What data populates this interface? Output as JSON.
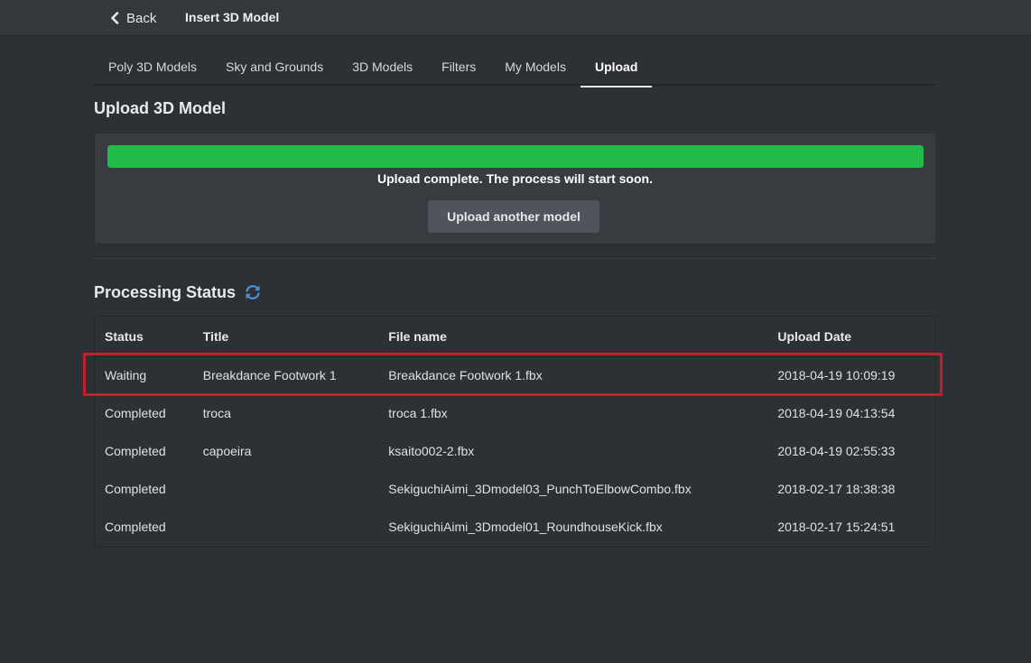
{
  "topbar": {
    "back_label": "Back",
    "title": "Insert 3D Model"
  },
  "tabs": [
    {
      "label": "Poly 3D Models",
      "active": false
    },
    {
      "label": "Sky and Grounds",
      "active": false
    },
    {
      "label": "3D Models",
      "active": false
    },
    {
      "label": "Filters",
      "active": false
    },
    {
      "label": "My Models",
      "active": false
    },
    {
      "label": "Upload",
      "active": true
    }
  ],
  "upload": {
    "heading": "Upload 3D Model",
    "progress": 1.0,
    "message": "Upload complete. The process will start soon.",
    "another_label": "Upload another model"
  },
  "processing": {
    "heading": "Processing Status",
    "columns": [
      "Status",
      "Title",
      "File name",
      "Upload Date"
    ],
    "rows": [
      {
        "status": "Waiting",
        "title": "Breakdance Footwork 1",
        "file": "Breakdance Footwork 1.fbx",
        "date": "2018-04-19 10:09:19",
        "highlighted": true
      },
      {
        "status": "Completed",
        "title": "troca",
        "file": "troca 1.fbx",
        "date": "2018-04-19 04:13:54"
      },
      {
        "status": "Completed",
        "title": "capoeira",
        "file": "ksaito002-2.fbx",
        "date": "2018-04-19 02:55:33"
      },
      {
        "status": "Completed",
        "title": "",
        "file": "SekiguchiAimi_3Dmodel03_PunchToElbowCombo.fbx",
        "date": "2018-02-17 18:38:38"
      },
      {
        "status": "Completed",
        "title": "",
        "file": "SekiguchiAimi_3Dmodel01_RoundhouseKick.fbx",
        "date": "2018-02-17 15:24:51"
      }
    ]
  },
  "colors": {
    "progress": "#21bb4a",
    "highlight": "#c4202b",
    "refresh_icon": "#4a90d9"
  },
  "icons": {
    "back": "chevron-left-icon",
    "refresh": "refresh-icon"
  }
}
